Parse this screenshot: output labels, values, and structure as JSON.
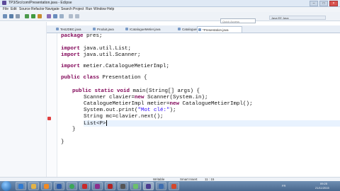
{
  "window": {
    "title": "TP3/Src/com/Presentation.java - Eclipse",
    "minimize": "–",
    "maximize": "□",
    "close": "×"
  },
  "menu": [
    "File",
    "Edit",
    "Source",
    "Refactor",
    "Navigate",
    "Search",
    "Project",
    "Run",
    "Window",
    "Help"
  ],
  "toolbar": {
    "quick_access_placeholder": "Quick Access",
    "perspective_label": "Java EE  Java"
  },
  "tabs": [
    {
      "label": "TestJDBC.java",
      "active": false
    },
    {
      "label": "Produit.java",
      "active": false
    },
    {
      "label": "ICatalogueMetier.java",
      "active": false
    },
    {
      "label": "CatalogueMetierImpl.java",
      "active": false
    },
    {
      "label": "*Presentation.java",
      "active": true
    }
  ],
  "code": {
    "l1": "package pres;",
    "l2a": "import",
    "l2b": " java.util.List;",
    "l3a": "import",
    "l3b": " java.util.Scanner;",
    "l4a": "import",
    "l4b": " metier.CatalogueMetierImpl;",
    "l5a": "public class",
    "l5b": " Presentation {",
    "l6a": "public static void",
    "l6b": " main(String[] args) {",
    "l7a": "Scanner clavier=",
    "l7b": "new",
    "l7c": " Scanner(System.in);",
    "l8a": "CatalogueMetierImpl metier=",
    "l8b": "new",
    "l8c": " CatalogueMetierImpl();",
    "l9a": "System.out.print(",
    "l9b": "\"Mot clé:\"",
    "l9c": ");",
    "l10": "String mc=clavier.next();",
    "l11": "List<P>",
    "l12": "}",
    "l13": "}"
  },
  "status": {
    "mode": "Writable",
    "insert": "Smart Insert",
    "position": "11 : 15"
  },
  "taskbar": {
    "lang": "FR",
    "time": "09:25",
    "date": "21/11/2015"
  }
}
